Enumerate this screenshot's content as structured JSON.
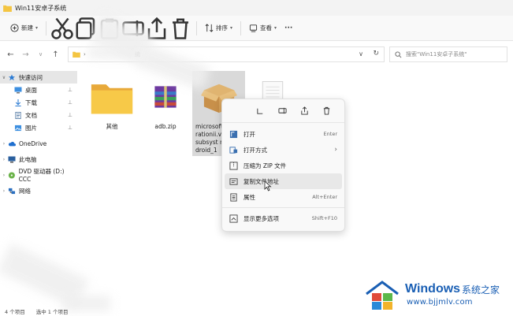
{
  "window": {
    "title": "Win11安卓子系统"
  },
  "toolbar": {
    "new_label": "新建",
    "sort_label": "排序",
    "view_label": "查看",
    "more_label": "···"
  },
  "address": {
    "breadcrumb_tail": "统",
    "search_placeholder": "搜索\"Win11安卓子系统\""
  },
  "sidebar": {
    "items": [
      {
        "label": "快速访问",
        "selected": true
      },
      {
        "label": "桌面"
      },
      {
        "label": "下载"
      },
      {
        "label": "文档"
      },
      {
        "label": "图片"
      },
      {
        "label": "OneDrive"
      },
      {
        "label": "此电脑"
      },
      {
        "label": "DVD 驱动器 (D:) CCC"
      },
      {
        "label": "网络"
      }
    ]
  },
  "files": [
    {
      "name": "其他",
      "type": "folder"
    },
    {
      "name": "adb.zip",
      "type": "archive"
    },
    {
      "name": "microsoft rationii.v ssubsyst ndroid_1",
      "type": "package",
      "selected": true
    },
    {
      "name": "",
      "type": "document"
    }
  ],
  "context_menu": {
    "items": [
      {
        "label": "打开",
        "shortcut": "Enter",
        "icon": "open-icon"
      },
      {
        "label": "打开方式",
        "shortcut": "›",
        "icon": "open-with-icon"
      },
      {
        "label": "压缩为 ZIP 文件",
        "shortcut": "",
        "icon": "zip-icon"
      },
      {
        "label": "复制文件地址",
        "shortcut": "",
        "icon": "copy-path-icon",
        "hover": true
      },
      {
        "label": "属性",
        "shortcut": "Alt+Enter",
        "icon": "properties-icon"
      },
      {
        "label": "显示更多选项",
        "shortcut": "Shift+F10",
        "icon": "more-options-icon"
      }
    ]
  },
  "status": {
    "item_count": "4 个项目",
    "selected": "选中 1 个项目"
  },
  "watermark": {
    "brand": "Windows",
    "brand_cn": "系统之家",
    "url": "www.bjjmlv.com"
  },
  "colors": {
    "accent": "#1a5fb4",
    "folder": "#f4c542",
    "selection": "#d9d9d9"
  }
}
